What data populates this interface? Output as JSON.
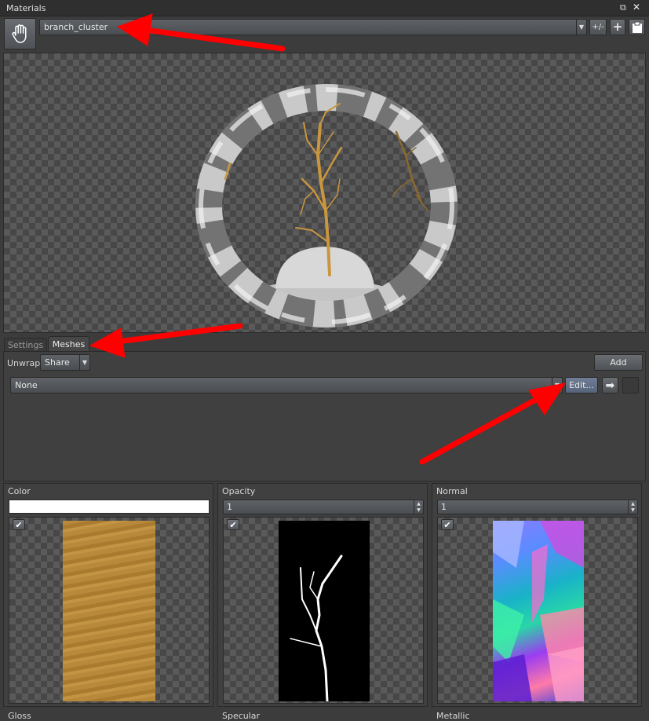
{
  "window": {
    "title": "Materials"
  },
  "toolbar": {
    "hand_icon": "hand-icon",
    "material_select": "branch_cluster",
    "plus_minus_label": "+/-",
    "add_icon": "plus-icon",
    "paste_icon": "clipboard-icon"
  },
  "tabs": [
    {
      "label": "Settings",
      "active": false
    },
    {
      "label": "Meshes",
      "active": true
    }
  ],
  "meshes": {
    "unwrap_label": "Unwrap",
    "unwrap_value": "Share",
    "add_label": "Add",
    "mesh_select": "None",
    "edit_label": "Edit...",
    "arrow_icon": "arrow-right-icon"
  },
  "textures": [
    {
      "label": "Color",
      "value": "",
      "enabled": true
    },
    {
      "label": "Opacity",
      "value": "1",
      "enabled": true
    },
    {
      "label": "Normal",
      "value": "1",
      "enabled": true
    }
  ],
  "bottom_labels": [
    "Gloss",
    "Specular",
    "Metallic"
  ],
  "colors": {
    "accent_annotation": "#ff0000",
    "bark": "#c9963f"
  }
}
